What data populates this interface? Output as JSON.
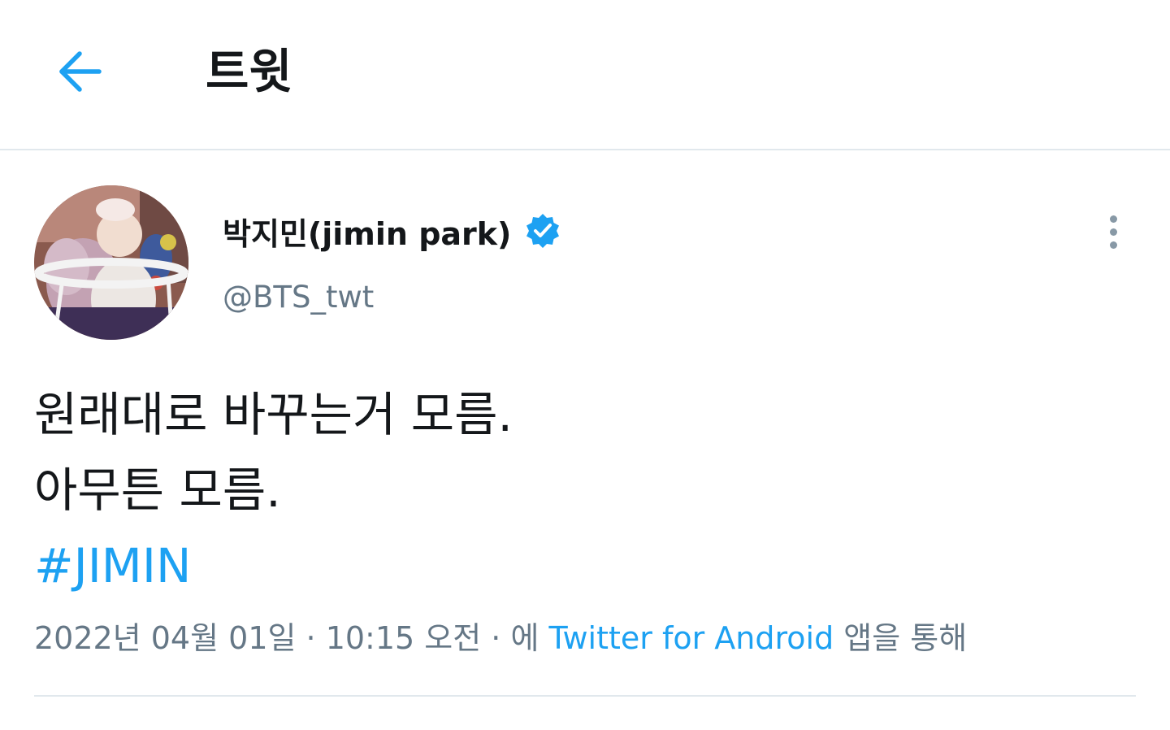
{
  "header": {
    "title": "트윗",
    "back_icon": "arrow-left-icon",
    "accent": "#1da1f2"
  },
  "tweet": {
    "display_name": "박지민(jimin park)",
    "handle": "@BTS_twt",
    "verified_icon": "verified-badge-icon",
    "more_icon": "more-vertical-icon",
    "lines": [
      "원래대로 바꾸는거 모름.",
      "아무튼 모름."
    ],
    "hashtag": "#JIMIN",
    "meta": {
      "date": "2022년 04월 01일",
      "sep1": " · ",
      "time": "10:15 오전",
      "sep2": " · ",
      "via_prefix": "에 ",
      "source": "Twitter for Android",
      "via_suffix": " 앱을 통해"
    }
  },
  "colors": {
    "text_primary": "#14171a",
    "text_secondary": "#657786",
    "link": "#1da1f2",
    "border": "#e1e8ed"
  }
}
